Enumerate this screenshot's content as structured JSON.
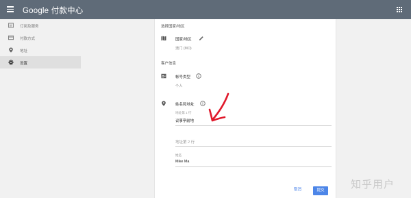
{
  "header": {
    "title": "Google 付款中心"
  },
  "sidebar": {
    "items": [
      {
        "label": "订阅及服务",
        "icon": "receipt-icon"
      },
      {
        "label": "付款方式",
        "icon": "credit-card-icon"
      },
      {
        "label": "地址",
        "icon": "location-pin-icon"
      },
      {
        "label": "设置",
        "icon": "gear-icon",
        "active": true
      }
    ]
  },
  "form": {
    "country_section_title": "选择国家/地区",
    "country_label": "国家/地区",
    "country_value": "澳门 (MO)",
    "customer_section_title": "客户信息",
    "account_type_label": "帐号类型",
    "account_type_value": "个人",
    "name_address_label": "姓名和地址",
    "address_line1_label": "地址第 1 行",
    "address_line1_value": "议事亭前地",
    "address_line2_placeholder": "地址第 2 行",
    "name_label": "姓名",
    "name_value": "Mike Ma"
  },
  "actions": {
    "cancel_label": "取消",
    "submit_label": "提交"
  },
  "colors": {
    "header_bg": "#5f6b78",
    "accent": "#4d86e8",
    "arrow": "#e0192b"
  },
  "watermark": {
    "text": "知乎用户"
  }
}
